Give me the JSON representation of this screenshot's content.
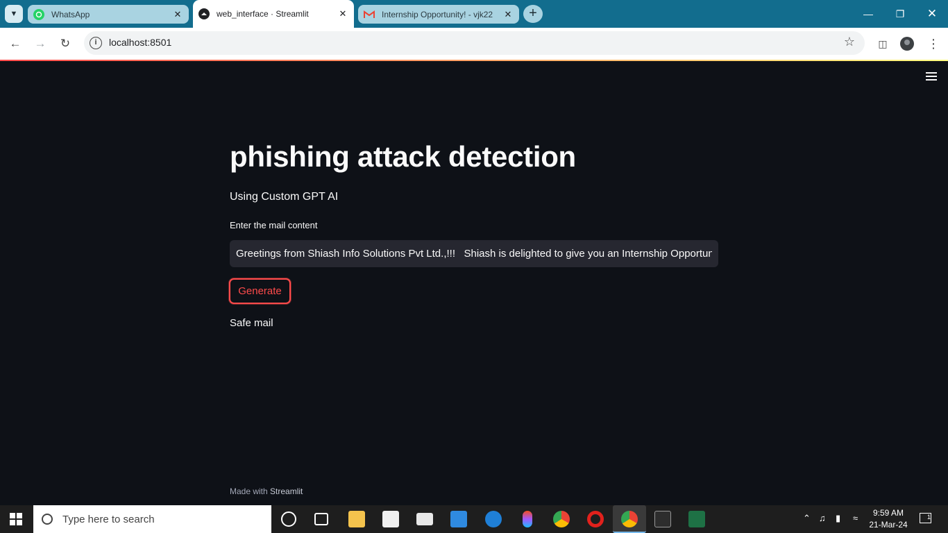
{
  "browser": {
    "tabs": [
      {
        "title": "WhatsApp",
        "favicon": "whatsapp-icon",
        "color": "#25d366"
      },
      {
        "title": "web_interface · Streamlit",
        "favicon": "streamlit-icon",
        "color": "#202124"
      },
      {
        "title": "Internship Opportunity! - vjk22",
        "favicon": "gmail-icon",
        "color": "#ea4335"
      }
    ],
    "new_tab_symbol": "+",
    "url": "localhost:8501"
  },
  "app": {
    "title": "phishing attack detection",
    "subtitle": "Using Custom GPT AI",
    "input_label": "Enter the mail content",
    "input_value": "Greetings from Shiash Info Solutions Pvt Ltd.,!!!   Shiash is delighted to give you an Internship Opportun",
    "button_label": "Generate",
    "result": "Safe mail",
    "footer_prefix": "Made with ",
    "footer_brand": "Streamlit",
    "accent_color": "#ff4b4b",
    "background_color": "#0e1117"
  },
  "taskbar": {
    "search_placeholder": "Type here to search",
    "time": "9:59 AM",
    "date": "21-Mar-24",
    "notification_count": "1",
    "apps": [
      "cortana-icon",
      "task-view-icon",
      "file-explorer-icon",
      "store-icon",
      "mail-icon",
      "vscode-icon",
      "edge-icon",
      "figma-icon",
      "chrome-icon",
      "opera-icon",
      "chrome-active-icon",
      "terminal-icon",
      "excel-icon"
    ]
  }
}
